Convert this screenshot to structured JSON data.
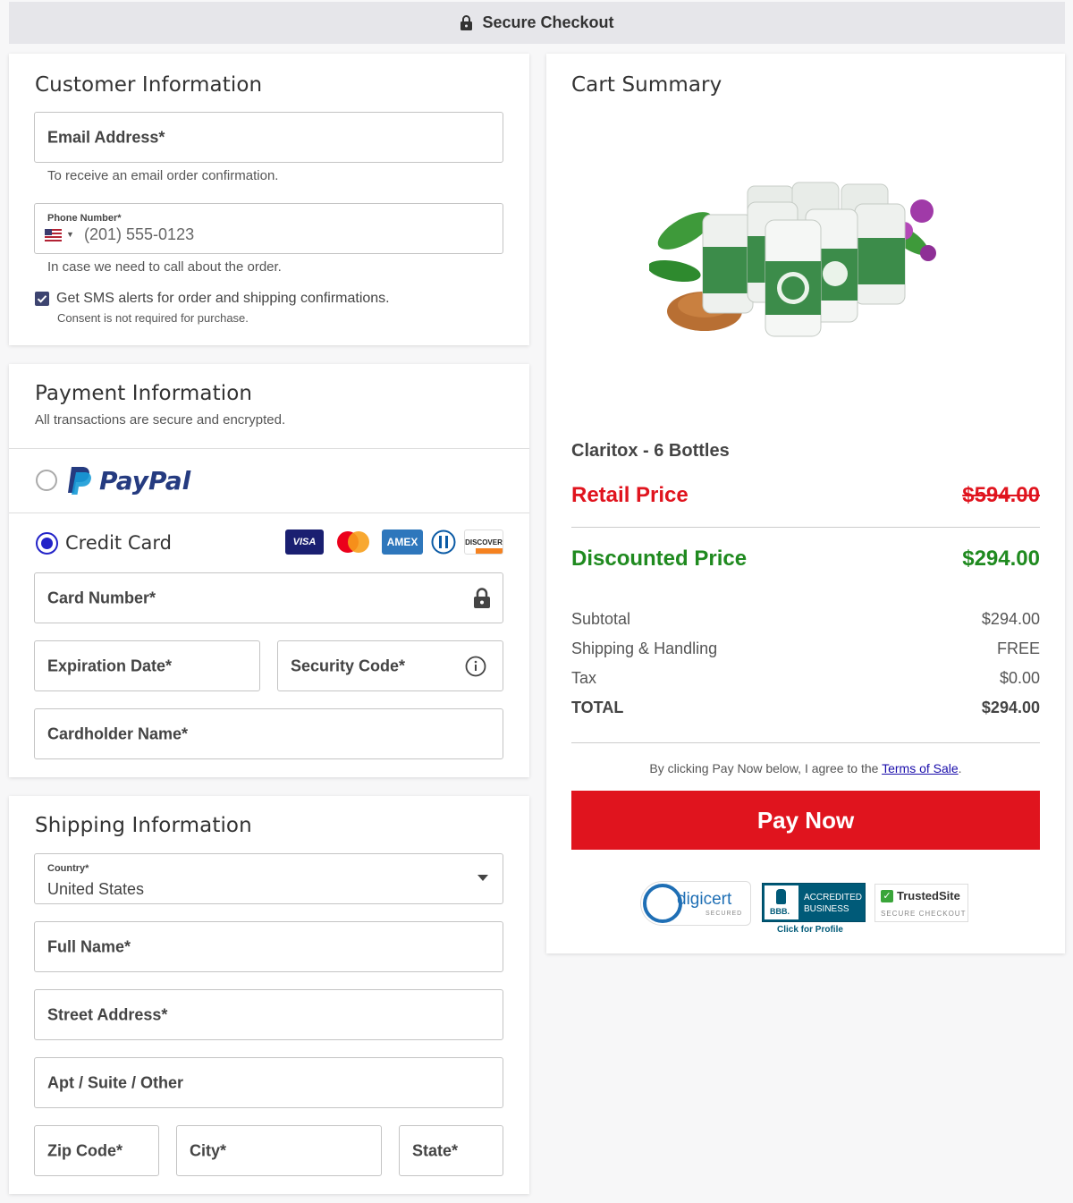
{
  "header": {
    "title": "Secure Checkout",
    "icon": "lock-icon"
  },
  "customer": {
    "title": "Customer Information",
    "email_label": "Email Address*",
    "email_helper": "To receive an email order confirmation.",
    "phone_label": "Phone Number*",
    "phone_placeholder": "(201) 555-0123",
    "phone_helper": "In case we need to call about the order.",
    "sms_label": "Get SMS alerts for order and shipping confirmations.",
    "sms_consent": "Consent is not required for purchase.",
    "sms_checked": true
  },
  "payment": {
    "title": "Payment Information",
    "subtitle": "All transactions are secure and encrypted.",
    "paypal_label": "PayPal",
    "paypal_selected": false,
    "credit_label": "Credit Card",
    "credit_selected": true,
    "card_brands": [
      "VISA",
      "Mastercard",
      "AMEX",
      "Diners",
      "DISCOVER"
    ],
    "card_number_label": "Card Number*",
    "expiration_label": "Expiration Date*",
    "security_label": "Security Code*",
    "cardholder_label": "Cardholder Name*"
  },
  "shipping": {
    "title": "Shipping Information",
    "country_label": "Country*",
    "country_value": "United States",
    "full_name_label": "Full Name*",
    "street_label": "Street Address*",
    "apt_label": "Apt / Suite / Other",
    "zip_label": "Zip Code*",
    "city_label": "City*",
    "state_label": "State*"
  },
  "cart": {
    "title": "Cart Summary",
    "product_name": "Claritox - 6 Bottles",
    "retail_label": "Retail Price",
    "retail_value": "$594.00",
    "discount_label": "Discounted Price",
    "discount_value": "$294.00",
    "subtotal_label": "Subtotal",
    "subtotal_value": "$294.00",
    "shipping_label": "Shipping & Handling",
    "shipping_value": "FREE",
    "tax_label": "Tax",
    "tax_value": "$0.00",
    "total_label": "TOTAL",
    "total_value": "$294.00",
    "agree_prefix": "By clicking Pay Now below, I agree to the ",
    "terms_link": "Terms of Sale",
    "agree_suffix": ".",
    "pay_button": "Pay Now",
    "badges": {
      "digicert": "digicert",
      "digicert_sub": "SECURED",
      "bbb_line1": "ACCREDITED",
      "bbb_line2": "BUSINESS",
      "bbb_logo": "BBB.",
      "bbb_profile": "Click for Profile",
      "trusted": "TrustedSite",
      "trusted_sub": "SECURE CHECKOUT"
    }
  },
  "colors": {
    "retail_red": "#e0141e",
    "discount_green": "#1f8a1f",
    "pay_button": "#e0141e",
    "radio_blue": "#2323c8",
    "link_blue": "#1a0dab"
  }
}
